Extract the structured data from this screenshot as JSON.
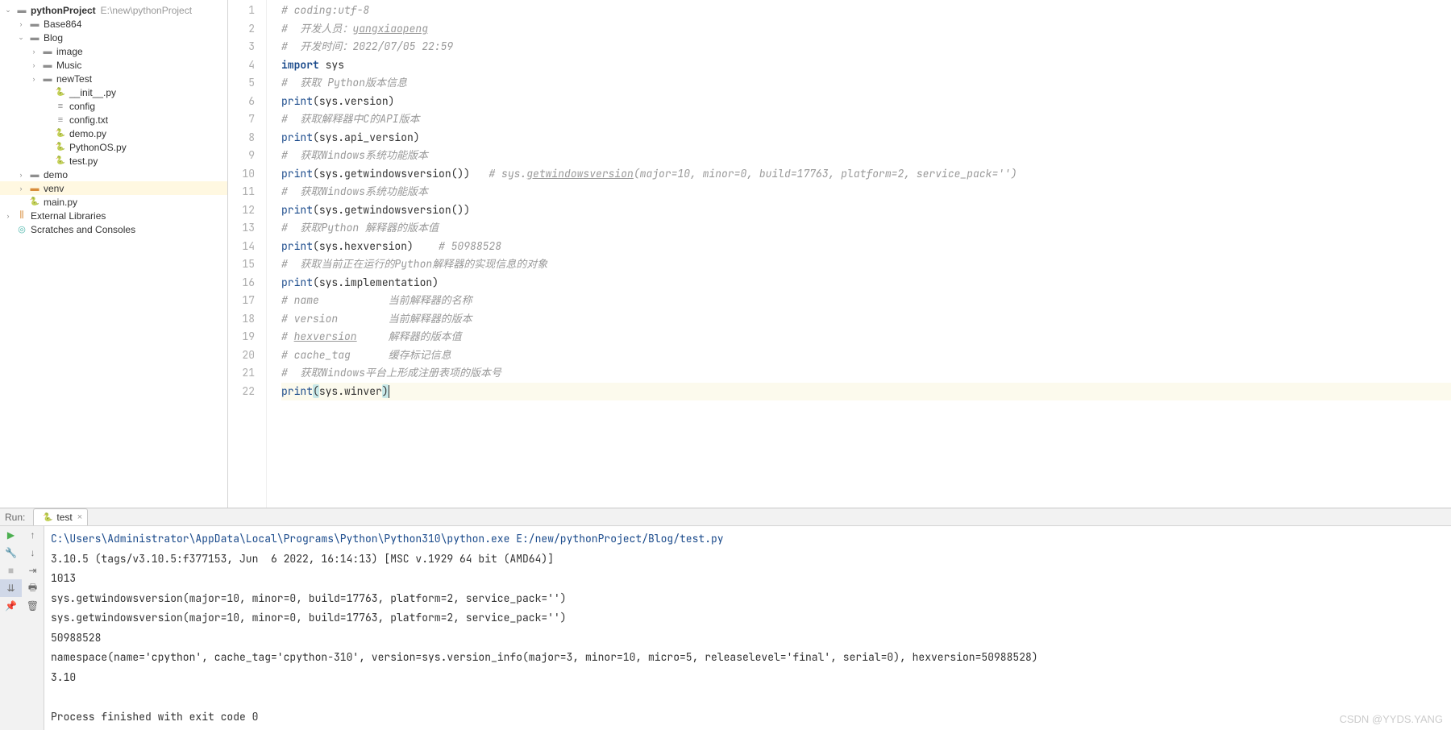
{
  "sidebar": {
    "root": {
      "name": "pythonProject",
      "path": "E:\\new\\pythonProject"
    },
    "items": [
      {
        "depth": 1,
        "chevron": ">",
        "icon": "folder",
        "label": "Base864"
      },
      {
        "depth": 1,
        "chevron": "v",
        "icon": "folder",
        "label": "Blog"
      },
      {
        "depth": 2,
        "chevron": ">",
        "icon": "folder",
        "label": "image"
      },
      {
        "depth": 2,
        "chevron": ">",
        "icon": "folder",
        "label": "Music"
      },
      {
        "depth": 2,
        "chevron": ">",
        "icon": "folder",
        "label": "newTest"
      },
      {
        "depth": 3,
        "chevron": "",
        "icon": "py",
        "label": "__init__.py"
      },
      {
        "depth": 3,
        "chevron": "",
        "icon": "file",
        "label": "config"
      },
      {
        "depth": 3,
        "chevron": "",
        "icon": "file",
        "label": "config.txt"
      },
      {
        "depth": 3,
        "chevron": "",
        "icon": "py",
        "label": "demo.py"
      },
      {
        "depth": 3,
        "chevron": "",
        "icon": "py",
        "label": "PythonOS.py"
      },
      {
        "depth": 3,
        "chevron": "",
        "icon": "py",
        "label": "test.py"
      },
      {
        "depth": 1,
        "chevron": ">",
        "icon": "folder",
        "label": "demo"
      },
      {
        "depth": 1,
        "chevron": ">",
        "icon": "folder-orange",
        "label": "venv",
        "selected": true
      },
      {
        "depth": 1,
        "chevron": "",
        "icon": "py",
        "label": "main.py"
      }
    ],
    "external_libs": "External Libraries",
    "scratches": "Scratches and Consoles"
  },
  "code": {
    "lines": [
      {
        "n": 1,
        "segs": [
          {
            "t": "# coding:utf-8",
            "c": "comment"
          }
        ]
      },
      {
        "n": 2,
        "segs": [
          {
            "t": "#  开发人员：",
            "c": "comment"
          },
          {
            "t": "yangxiaopeng",
            "c": "comment under"
          }
        ]
      },
      {
        "n": 3,
        "segs": [
          {
            "t": "#  开发时间：2022/07/05 22:59",
            "c": "comment"
          }
        ]
      },
      {
        "n": 4,
        "segs": [
          {
            "t": "import ",
            "c": "keyword"
          },
          {
            "t": "sys",
            "c": "normal"
          }
        ]
      },
      {
        "n": 5,
        "segs": [
          {
            "t": "#  获取 Python版本信息",
            "c": "comment"
          }
        ]
      },
      {
        "n": 6,
        "segs": [
          {
            "t": "print",
            "c": "builtin"
          },
          {
            "t": "(sys.version)",
            "c": "normal"
          }
        ]
      },
      {
        "n": 7,
        "segs": [
          {
            "t": "#  获取解释器中C的API版本",
            "c": "comment"
          }
        ]
      },
      {
        "n": 8,
        "segs": [
          {
            "t": "print",
            "c": "builtin"
          },
          {
            "t": "(sys.api_version)",
            "c": "normal"
          }
        ]
      },
      {
        "n": 9,
        "segs": [
          {
            "t": "#  获取Windows系统功能版本",
            "c": "comment"
          }
        ]
      },
      {
        "n": 10,
        "segs": [
          {
            "t": "print",
            "c": "builtin"
          },
          {
            "t": "(sys.getwindowsversion())   ",
            "c": "normal"
          },
          {
            "t": "# sys.",
            "c": "comment"
          },
          {
            "t": "getwindowsversion",
            "c": "comment under"
          },
          {
            "t": "(major=10, minor=0, build=17763, platform=2, service_pack='')",
            "c": "comment"
          }
        ]
      },
      {
        "n": 11,
        "segs": [
          {
            "t": "#  获取Windows系统功能版本",
            "c": "comment"
          }
        ]
      },
      {
        "n": 12,
        "segs": [
          {
            "t": "print",
            "c": "builtin"
          },
          {
            "t": "(sys.getwindowsversion())",
            "c": "normal"
          }
        ]
      },
      {
        "n": 13,
        "segs": [
          {
            "t": "#  获取Python 解释器的版本值",
            "c": "comment"
          }
        ]
      },
      {
        "n": 14,
        "segs": [
          {
            "t": "print",
            "c": "builtin"
          },
          {
            "t": "(sys.hexversion)    ",
            "c": "normal"
          },
          {
            "t": "# 50988528",
            "c": "comment"
          }
        ]
      },
      {
        "n": 15,
        "segs": [
          {
            "t": "#  获取当前正在运行的Python解释器的实现信息的对象",
            "c": "comment"
          }
        ]
      },
      {
        "n": 16,
        "segs": [
          {
            "t": "print",
            "c": "builtin"
          },
          {
            "t": "(sys.implementation)",
            "c": "normal"
          }
        ]
      },
      {
        "n": 17,
        "segs": [
          {
            "t": "# name           当前解释器的名称",
            "c": "comment"
          }
        ]
      },
      {
        "n": 18,
        "segs": [
          {
            "t": "# version        当前解释器的版本",
            "c": "comment"
          }
        ]
      },
      {
        "n": 19,
        "segs": [
          {
            "t": "# ",
            "c": "comment"
          },
          {
            "t": "hexversion",
            "c": "comment under"
          },
          {
            "t": "     解释器的版本值",
            "c": "comment"
          }
        ]
      },
      {
        "n": 20,
        "segs": [
          {
            "t": "# cache_tag      缓存标记信息",
            "c": "comment"
          }
        ]
      },
      {
        "n": 21,
        "segs": [
          {
            "t": "#  获取Windows平台上形成注册表项的版本号",
            "c": "comment"
          }
        ]
      },
      {
        "n": 22,
        "current": true,
        "segs": [
          {
            "t": "print",
            "c": "builtin"
          },
          {
            "t": "(",
            "c": "normal hl"
          },
          {
            "t": "sys.winver",
            "c": "normal"
          },
          {
            "t": ")",
            "c": "normal hl"
          }
        ],
        "caret": true
      }
    ]
  },
  "run": {
    "label": "Run:",
    "tab": "test",
    "output": [
      {
        "t": "C:\\Users\\Administrator\\AppData\\Local\\Programs\\Python\\Python310\\python.exe E:/new/pythonProject/Blog/test.py",
        "c": "path"
      },
      {
        "t": "3.10.5 (tags/v3.10.5:f377153, Jun  6 2022, 16:14:13) [MSC v.1929 64 bit (AMD64)]"
      },
      {
        "t": "1013"
      },
      {
        "t": "sys.getwindowsversion(major=10, minor=0, build=17763, platform=2, service_pack='')"
      },
      {
        "t": "sys.getwindowsversion(major=10, minor=0, build=17763, platform=2, service_pack='')"
      },
      {
        "t": "50988528"
      },
      {
        "t": "namespace(name='cpython', cache_tag='cpython-310', version=sys.version_info(major=3, minor=10, micro=5, releaselevel='final', serial=0), hexversion=50988528)"
      },
      {
        "t": "3.10"
      },
      {
        "t": ""
      },
      {
        "t": "Process finished with exit code 0"
      }
    ]
  },
  "watermark": "CSDN @YYDS.YANG"
}
